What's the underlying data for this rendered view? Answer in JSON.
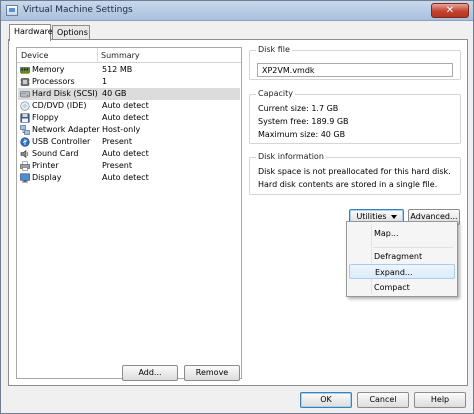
{
  "window": {
    "title": "Virtual Machine Settings",
    "close_label": "✕"
  },
  "tabs": [
    {
      "label": "Hardware"
    },
    {
      "label": "Options"
    }
  ],
  "device_list": {
    "columns": {
      "device": "Device",
      "summary": "Summary"
    },
    "rows": [
      {
        "name": "Memory",
        "summary": "512 MB",
        "icon": "memory-icon"
      },
      {
        "name": "Processors",
        "summary": "1",
        "icon": "processor-icon"
      },
      {
        "name": "Hard Disk (SCSI)",
        "summary": "40 GB",
        "icon": "hard-disk-icon",
        "selected": true
      },
      {
        "name": "CD/DVD (IDE)",
        "summary": "Auto detect",
        "icon": "cd-dvd-icon"
      },
      {
        "name": "Floppy",
        "summary": "Auto detect",
        "icon": "floppy-icon"
      },
      {
        "name": "Network Adapter",
        "summary": "Host-only",
        "icon": "network-adapter-icon"
      },
      {
        "name": "USB Controller",
        "summary": "Present",
        "icon": "usb-icon"
      },
      {
        "name": "Sound Card",
        "summary": "Auto detect",
        "icon": "sound-card-icon"
      },
      {
        "name": "Printer",
        "summary": "Present",
        "icon": "printer-icon"
      },
      {
        "name": "Display",
        "summary": "Auto detect",
        "icon": "display-icon"
      }
    ],
    "add_label": "Add...",
    "remove_label": "Remove"
  },
  "disk_file": {
    "label": "Disk file",
    "value": "XP2VM.vmdk"
  },
  "capacity": {
    "label": "Capacity",
    "current": "Current size:  1.7 GB",
    "system_free": "System free:  189.9 GB",
    "maximum": "Maximum size:  40 GB"
  },
  "disk_information": {
    "label": "Disk information",
    "line1": "Disk space is not preallocated for this hard disk.",
    "line2": "Hard disk contents are stored in a single file."
  },
  "utilities_label": "Utilities",
  "advanced_label": "Advanced...",
  "utilities_menu": [
    {
      "label": "Map...",
      "hot": false
    },
    {
      "label": "Defragment",
      "hot": false
    },
    {
      "label": "Expand...",
      "hot": true
    },
    {
      "label": "Compact",
      "hot": false
    }
  ],
  "footer": {
    "ok": "OK",
    "cancel": "Cancel",
    "help": "Help"
  },
  "colors": {
    "selection": "#dcdcdc",
    "menu_hot": "#dcebfc",
    "title_bar": "#b9cde6"
  }
}
